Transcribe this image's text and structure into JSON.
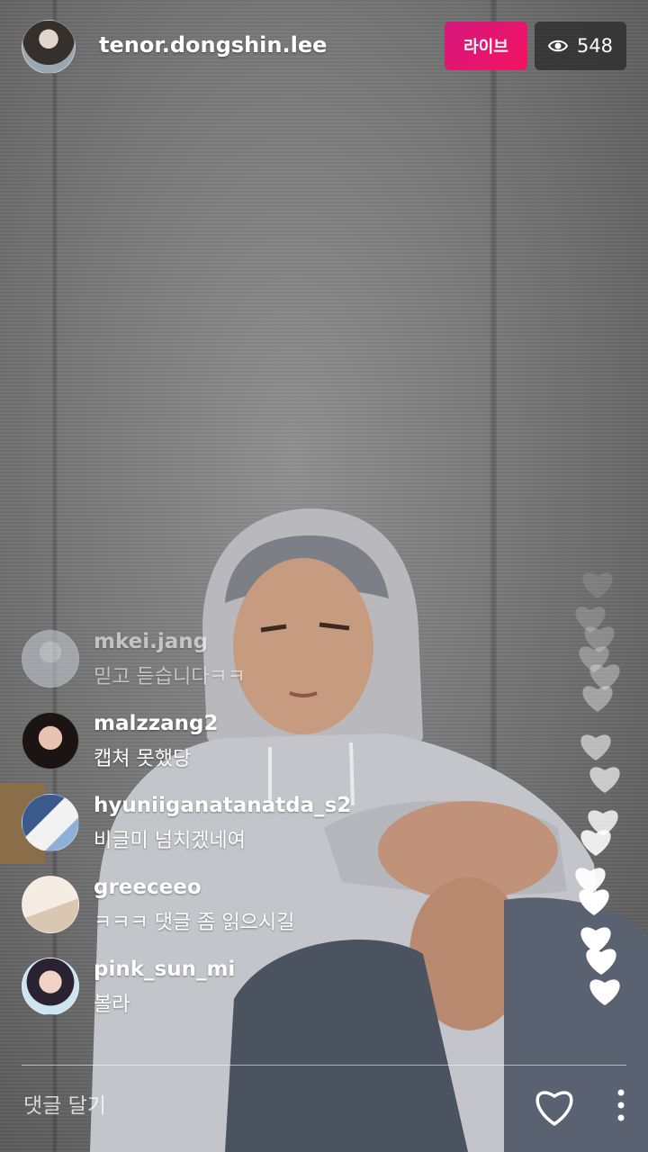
{
  "host": {
    "username": "tenor.dongshin.lee"
  },
  "live_badge": "라이브",
  "viewers": "548",
  "comments": [
    {
      "user": "mkei.jang",
      "text": "믿고 듣습니다ㅋㅋ",
      "faded": true
    },
    {
      "user": "malzzang2",
      "text": "캡쳐 못했당"
    },
    {
      "user": "hyuniiganatanatda_s2",
      "text": "비글미 넘치겠네여"
    },
    {
      "user": "greeceeo",
      "text": "ㅋㅋㅋ 댓글 좀 읽으시길"
    },
    {
      "user": "pink_sun_mi",
      "text": "볼라"
    }
  ],
  "comment_input": {
    "placeholder": "댓글 달기"
  },
  "icons": {
    "views": "eye-icon",
    "like": "heart-outline-icon",
    "more": "more-vertical-icon",
    "floating": "heart-icon"
  },
  "colors": {
    "live_badge": "#e5146e",
    "viewer_badge": "#282828"
  }
}
